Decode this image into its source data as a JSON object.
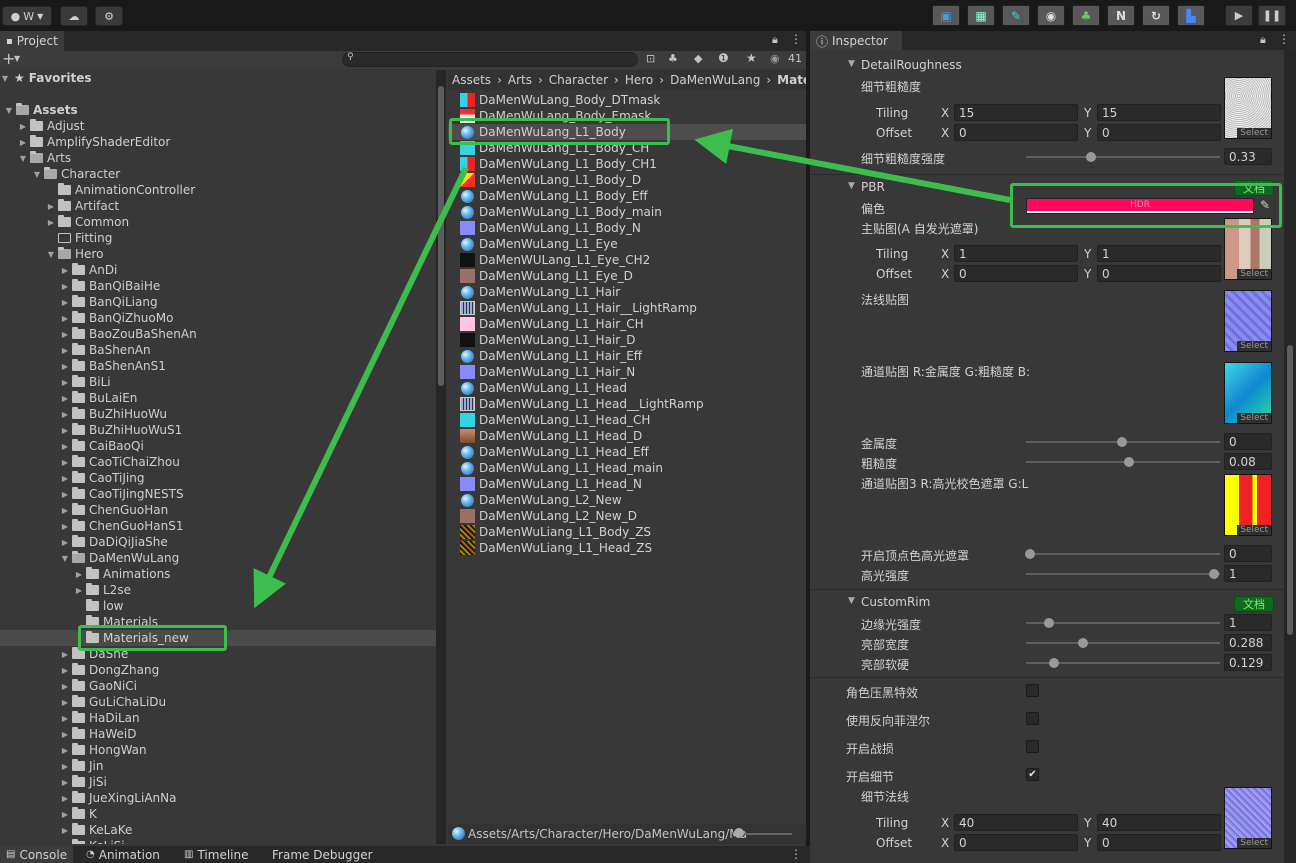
{
  "toolbar": {
    "account_label": "W",
    "right_buttons": [
      "scene",
      "frame",
      "brush",
      "eye",
      "tree",
      "N",
      "refresh",
      "bag"
    ],
    "n_label": "N"
  },
  "project": {
    "tab_label": "Project",
    "favorites_label": "Favorites",
    "hidden_count": "41",
    "tree": [
      {
        "label": "Assets",
        "depth": 0,
        "arrow": "down",
        "bold": true
      },
      {
        "label": "Adjust",
        "depth": 1,
        "arrow": "right"
      },
      {
        "label": "AmplifyShaderEditor",
        "depth": 1,
        "arrow": "right"
      },
      {
        "label": "Arts",
        "depth": 1,
        "arrow": "down"
      },
      {
        "label": "Character",
        "depth": 2,
        "arrow": "down"
      },
      {
        "label": "AnimationController",
        "depth": 3,
        "arrow": ""
      },
      {
        "label": "Artifact",
        "depth": 3,
        "arrow": "right"
      },
      {
        "label": "Common",
        "depth": 3,
        "arrow": "right"
      },
      {
        "label": "Fitting",
        "depth": 3,
        "arrow": "",
        "empty": true
      },
      {
        "label": "Hero",
        "depth": 3,
        "arrow": "down"
      },
      {
        "label": "AnDi",
        "depth": 4,
        "arrow": "right"
      },
      {
        "label": "BanQiBaiHe",
        "depth": 4,
        "arrow": "right"
      },
      {
        "label": "BanQiLiang",
        "depth": 4,
        "arrow": "right"
      },
      {
        "label": "BanQiZhuoMo",
        "depth": 4,
        "arrow": "right"
      },
      {
        "label": "BaoZouBaShenAn",
        "depth": 4,
        "arrow": "right"
      },
      {
        "label": "BaShenAn",
        "depth": 4,
        "arrow": "right"
      },
      {
        "label": "BaShenAnS1",
        "depth": 4,
        "arrow": "right"
      },
      {
        "label": "BiLi",
        "depth": 4,
        "arrow": "right"
      },
      {
        "label": "BuLaiEn",
        "depth": 4,
        "arrow": "right"
      },
      {
        "label": "BuZhiHuoWu",
        "depth": 4,
        "arrow": "right"
      },
      {
        "label": "BuZhiHuoWuS1",
        "depth": 4,
        "arrow": "right"
      },
      {
        "label": "CaiBaoQi",
        "depth": 4,
        "arrow": "right"
      },
      {
        "label": "CaoTiChaiZhou",
        "depth": 4,
        "arrow": "right"
      },
      {
        "label": "CaoTiJing",
        "depth": 4,
        "arrow": "right"
      },
      {
        "label": "CaoTiJingNESTS",
        "depth": 4,
        "arrow": "right"
      },
      {
        "label": "ChenGuoHan",
        "depth": 4,
        "arrow": "right"
      },
      {
        "label": "ChenGuoHanS1",
        "depth": 4,
        "arrow": "right"
      },
      {
        "label": "DaDiQiJiaShe",
        "depth": 4,
        "arrow": "right"
      },
      {
        "label": "DaMenWuLang",
        "depth": 4,
        "arrow": "down"
      },
      {
        "label": "Animations",
        "depth": 5,
        "arrow": "right"
      },
      {
        "label": "L2se",
        "depth": 5,
        "arrow": "right"
      },
      {
        "label": "low",
        "depth": 5,
        "arrow": ""
      },
      {
        "label": "Materials",
        "depth": 5,
        "arrow": ""
      },
      {
        "label": "Materials_new",
        "depth": 5,
        "arrow": "",
        "selected": true
      },
      {
        "label": "DaShe",
        "depth": 4,
        "arrow": "right"
      },
      {
        "label": "DongZhang",
        "depth": 4,
        "arrow": "right"
      },
      {
        "label": "GaoNiCi",
        "depth": 4,
        "arrow": "right"
      },
      {
        "label": "GuLiChaLiDu",
        "depth": 4,
        "arrow": "right"
      },
      {
        "label": "HaDiLan",
        "depth": 4,
        "arrow": "right"
      },
      {
        "label": "HaWeiD",
        "depth": 4,
        "arrow": "right"
      },
      {
        "label": "HongWan",
        "depth": 4,
        "arrow": "right"
      },
      {
        "label": "Jin",
        "depth": 4,
        "arrow": "right"
      },
      {
        "label": "JiSi",
        "depth": 4,
        "arrow": "right"
      },
      {
        "label": "JueXingLiAnNa",
        "depth": 4,
        "arrow": "right"
      },
      {
        "label": "K",
        "depth": 4,
        "arrow": "right"
      },
      {
        "label": "KeLaKe",
        "depth": 4,
        "arrow": "right"
      },
      {
        "label": "KeLiSi",
        "depth": 4,
        "arrow": "right"
      }
    ],
    "breadcrumb": [
      "Assets",
      "Arts",
      "Character",
      "Hero",
      "DaMenWuLang",
      "Mater"
    ],
    "files": [
      {
        "name": "DaMenWuLang_Body_DTmask",
        "icon": "ic-red"
      },
      {
        "name": "DaMenWuLang_Body_Emask",
        "icon": "ic-white"
      },
      {
        "name": "DaMenWuLang_L1_Body",
        "icon": "ic-sphere",
        "selected": true
      },
      {
        "name": "DaMenWuLang_L1_Body_CH",
        "icon": "ic-cyan"
      },
      {
        "name": "DaMenWuLang_L1_Body_CH1",
        "icon": "ic-red"
      },
      {
        "name": "DaMenWuLang_L1_Body_D",
        "icon": "ic-yellow"
      },
      {
        "name": "DaMenWuLang_L1_Body_Eff",
        "icon": "ic-sphere"
      },
      {
        "name": "DaMenWuLang_L1_Body_main",
        "icon": "ic-sphere"
      },
      {
        "name": "DaMenWuLang_L1_Body_N",
        "icon": "ic-blue"
      },
      {
        "name": "DaMenWuLang_L1_Eye",
        "icon": "ic-sphere"
      },
      {
        "name": "DaMenWULang_L1_Eye_CH2",
        "icon": "ic-dark"
      },
      {
        "name": "DaMenWuLang_L1_Eye_D",
        "icon": "ic-face"
      },
      {
        "name": "DaMenWuLang_L1_Hair",
        "icon": "ic-sphere"
      },
      {
        "name": "DaMenWuLang_L1_Hair__LightRamp",
        "icon": "ic-ramp"
      },
      {
        "name": "DaMenWuLang_L1_Hair_CH",
        "icon": "ic-pink"
      },
      {
        "name": "DaMenWuLang_L1_Hair_D",
        "icon": "ic-dark"
      },
      {
        "name": "DaMenWuLang_L1_Hair_Eff",
        "icon": "ic-sphere"
      },
      {
        "name": "DaMenWuLang_L1_Hair_N",
        "icon": "ic-blue"
      },
      {
        "name": "DaMenWuLang_L1_Head",
        "icon": "ic-sphere"
      },
      {
        "name": "DaMenWuLang_L1_Head__LightRamp",
        "icon": "ic-ramp"
      },
      {
        "name": "DaMenWuLang_L1_Head_CH",
        "icon": "ic-cyan"
      },
      {
        "name": "DaMenWuLang_L1_Head_D",
        "icon": "ic-face2"
      },
      {
        "name": "DaMenWuLang_L1_Head_Eff",
        "icon": "ic-sphere"
      },
      {
        "name": "DaMenWuLang_L1_Head_main",
        "icon": "ic-sphere"
      },
      {
        "name": "DaMenWuLang_L1_Head_N",
        "icon": "ic-blue"
      },
      {
        "name": "DaMenWuLang_L2_New",
        "icon": "ic-sphere"
      },
      {
        "name": "DaMenWuLang_L2_New_D",
        "icon": "ic-face"
      },
      {
        "name": "DaMenWuLiang_L1_Body_ZS",
        "icon": "ic-zs"
      },
      {
        "name": "DaMenWuLiang_L1_Head_ZS",
        "icon": "ic-zs"
      }
    ],
    "path_bar": "Assets/Arts/Character/Hero/DaMenWuLang/Ma"
  },
  "inspector": {
    "tab_label": "Inspector",
    "detail_roughness": "DetailRoughness",
    "detail_rough_tex": "细节粗糙度",
    "tiling": "Tiling",
    "offset": "Offset",
    "x": "X",
    "y": "Y",
    "dr_tiling_x": "15",
    "dr_tiling_y": "15",
    "dr_offset_x": "0",
    "dr_offset_y": "0",
    "detail_rough_strength": "细节粗糙度强度",
    "detail_rough_strength_val": "0.33",
    "pbr": "PBR",
    "doc_label": "文档",
    "tint": "偏色",
    "hdr": "HDR",
    "main_tex": "主贴图(A 自发光遮罩)",
    "main_tiling_x": "1",
    "main_tiling_y": "1",
    "main_offset_x": "0",
    "main_offset_y": "0",
    "normal_tex": "法线贴图",
    "channel_tex": "通道贴图 R:金属度 G:粗糙度 B:",
    "metallic": "金属度",
    "metallic_val": "0",
    "roughness": "粗糙度",
    "roughness_val": "0.08",
    "channel_tex3": "通道贴图3 R:高光校色遮罩 G:L",
    "vertex_mask": "开启顶点色高光遮罩",
    "vertex_mask_val": "0",
    "spec_strength": "高光强度",
    "spec_strength_val": "1",
    "custom_rim": "CustomRim",
    "rim_strength": "边缘光强度",
    "rim_strength_val": "1",
    "bright_width": "亮部宽度",
    "bright_width_val": "0.288",
    "bright_soft": "亮部软硬",
    "bright_soft_val": "0.129",
    "char_dark": "角色压黑特效",
    "reverse_fresnel": "使用反向菲涅尔",
    "battle_damage": "开启战损",
    "enable_detail": "开启细节",
    "detail_normal": "细节法线",
    "dn_tiling_x": "40",
    "dn_tiling_y": "40",
    "dn_offset_x": "0",
    "dn_offset_y": "0",
    "select": "Select",
    "tint_color": "#ff0a5a"
  },
  "bottom_tabs": [
    "Console",
    "Animation",
    "Timeline",
    "Frame Debugger"
  ],
  "colors": {
    "highlight": "#3dbd4d",
    "arrow": "#3dbd4d"
  }
}
